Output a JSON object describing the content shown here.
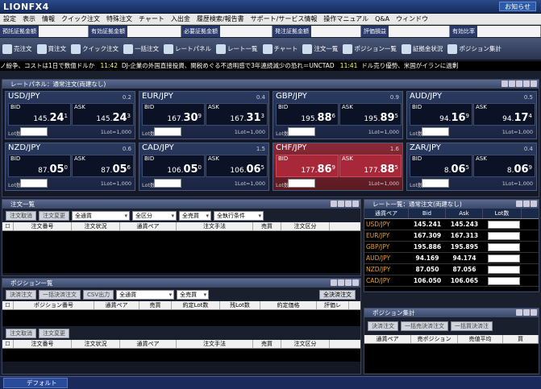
{
  "app": {
    "logo": "LIONFX4",
    "notice": "お知らせ"
  },
  "menu": [
    "設定",
    "表示",
    "情報",
    "クイック注文",
    "特殊注文",
    "チャート",
    "入出金",
    "履歴検索/報告書",
    "サポート/サービス情報",
    "操作マニュアル",
    "Q&A",
    "ウィンドウ"
  ],
  "account": [
    "預託証拠金額",
    "有効証拠金額",
    "必要証拠金額",
    "発注証拠金額",
    "評価損益",
    "有効比率"
  ],
  "toolbar": [
    "売注文",
    "買注文",
    "クイック注文",
    "一括注文",
    "レートパネル",
    "レート一覧",
    "チャート",
    "注文一覧",
    "ポジション一覧",
    "証拠金状況",
    "ポジション集計"
  ],
  "ticker": {
    "lead": "ノ紛争、コストは1日で数億ドルか",
    "t1": "11:42",
    "m1": "DJ-企業の外国直接投資、関税めぐる不透明感で3年連続減少の恐れ＝UNCTAD",
    "t2": "11:41",
    "m2": "ドル売り優勢、米国がイランに過剰"
  },
  "rate_panel": {
    "title": "レートパネル：通常注文(両建なし)",
    "tiles": [
      {
        "pair": "USD/JPY",
        "spread": "0.2",
        "bid_a": "145.",
        "bid_b": "24",
        "bid_c": "1",
        "ask_a": "145.",
        "ask_b": "24",
        "ask_c": "3",
        "lot": "1Lot=1,000",
        "red": false
      },
      {
        "pair": "EUR/JPY",
        "spread": "0.4",
        "bid_a": "167.",
        "bid_b": "30",
        "bid_c": "9",
        "ask_a": "167.",
        "ask_b": "31",
        "ask_c": "3",
        "lot": "1Lot=1,000",
        "red": false
      },
      {
        "pair": "GBP/JPY",
        "spread": "0.9",
        "bid_a": "195.",
        "bid_b": "88",
        "bid_c": "6",
        "ask_a": "195.",
        "ask_b": "89",
        "ask_c": "5",
        "lot": "1Lot=1,000",
        "red": false
      },
      {
        "pair": "AUD/JPY",
        "spread": "0.5",
        "bid_a": "94.",
        "bid_b": "16",
        "bid_c": "9",
        "ask_a": "94.",
        "ask_b": "17",
        "ask_c": "4",
        "lot": "1Lot=1,000",
        "red": false
      },
      {
        "pair": "NZD/JPY",
        "spread": "0.6",
        "bid_a": "87.",
        "bid_b": "05",
        "bid_c": "0",
        "ask_a": "87.",
        "ask_b": "05",
        "ask_c": "6",
        "lot": "1Lot=1,000",
        "red": false
      },
      {
        "pair": "CAD/JPY",
        "spread": "1.5",
        "bid_a": "106.",
        "bid_b": "05",
        "bid_c": "0",
        "ask_a": "106.",
        "ask_b": "06",
        "ask_c": "5",
        "lot": "1Lot=1,000",
        "red": false
      },
      {
        "pair": "CHF/JPY",
        "spread": "1.6",
        "bid_a": "177.",
        "bid_b": "86",
        "bid_c": "9",
        "ask_a": "177.",
        "ask_b": "88",
        "ask_c": "5",
        "lot": "1Lot=1,000",
        "red": true
      },
      {
        "pair": "ZAR/JPY",
        "spread": "0.4",
        "bid_a": "8.",
        "bid_b": "06",
        "bid_c": "5",
        "ask_a": "8.",
        "ask_b": "06",
        "ask_c": "9",
        "lot": "1Lot=1,000",
        "red": false
      }
    ],
    "bid_label": "BID",
    "ask_label": "ASK",
    "lot_label": "Lot数"
  },
  "orders": {
    "title": "注文一覧",
    "buttons": [
      "注文取消",
      "注文変更"
    ],
    "filters": [
      "全通貨",
      "全区分",
      "全売買",
      "全執行条件"
    ],
    "columns": [
      "注文番号",
      "注文状況",
      "通貨ペア",
      "注文手法",
      "売買",
      "注文区分"
    ]
  },
  "rate_list": {
    "title": "レート一覧：通常注文(両建なし)",
    "columns": [
      "通貨ペア",
      "Bid",
      "Ask",
      "Lot数"
    ],
    "rows": [
      {
        "pair": "USD/JPY",
        "bid": "145.241",
        "ask": "145.243"
      },
      {
        "pair": "EUR/JPY",
        "bid": "167.309",
        "ask": "167.313"
      },
      {
        "pair": "GBP/JPY",
        "bid": "195.886",
        "ask": "195.895"
      },
      {
        "pair": "AUD/JPY",
        "bid": "94.169",
        "ask": "94.174"
      },
      {
        "pair": "NZD/JPY",
        "bid": "87.050",
        "ask": "87.056"
      },
      {
        "pair": "CAD/JPY",
        "bid": "106.050",
        "ask": "106.065"
      }
    ]
  },
  "positions": {
    "title": "ポジション一覧",
    "buttons": [
      "決済注文",
      "一括決済注文",
      "CSV出力"
    ],
    "filters": [
      "全通貨",
      "全売買"
    ],
    "settle_all": "全決済注文",
    "columns": [
      "ポジション番号",
      "通貨ペア",
      "売買",
      "約定Lot数",
      "残Lot数",
      "約定価格",
      "評価レ"
    ],
    "sub_buttons": [
      "注文取消",
      "注文変更"
    ],
    "sub_columns": [
      "注文番号",
      "注文状況",
      "通貨ペア",
      "注文手法",
      "売買",
      "注文区分"
    ]
  },
  "summary": {
    "title": "ポジション集計",
    "buttons": [
      "決済注文",
      "一括売決済注文",
      "一括買決済注"
    ],
    "columns": [
      "通貨ペア",
      "売ポジション",
      "売値平均",
      "買"
    ]
  },
  "status": {
    "tab": "デフォルト"
  }
}
